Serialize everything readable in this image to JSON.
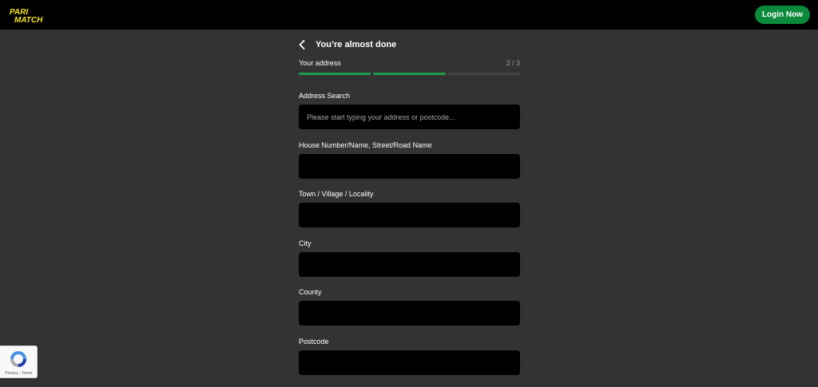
{
  "header": {
    "logo_alt": "PARIMATCH",
    "logo_line1": "PARI",
    "logo_line2": "MATCH",
    "login_label": "Login Now"
  },
  "form": {
    "title": "You’re almost done",
    "step_label": "Your address",
    "step_count": "2 / 3",
    "progress": {
      "current": 2,
      "total": 3
    },
    "fields": [
      {
        "label": "Address Search",
        "placeholder": "Please start typing your address or postcode...",
        "value": ""
      },
      {
        "label": "House Number/Name, Street/Road Name",
        "placeholder": "",
        "value": ""
      },
      {
        "label": "Town / Village / Locality",
        "placeholder": "",
        "value": ""
      },
      {
        "label": "City",
        "placeholder": "",
        "value": ""
      },
      {
        "label": "County",
        "placeholder": "",
        "value": ""
      },
      {
        "label": "Postcode",
        "placeholder": "",
        "value": ""
      }
    ]
  },
  "recaptcha": {
    "links": "Privacy - Terms"
  },
  "colors": {
    "background": "#333333",
    "header": "#000000",
    "accent_green": "#0a8a3a",
    "logo_yellow": "#f5e41c",
    "input_bg": "#000000"
  },
  "icons": {
    "back": "chevron-left-icon",
    "recaptcha": "recaptcha-icon"
  }
}
